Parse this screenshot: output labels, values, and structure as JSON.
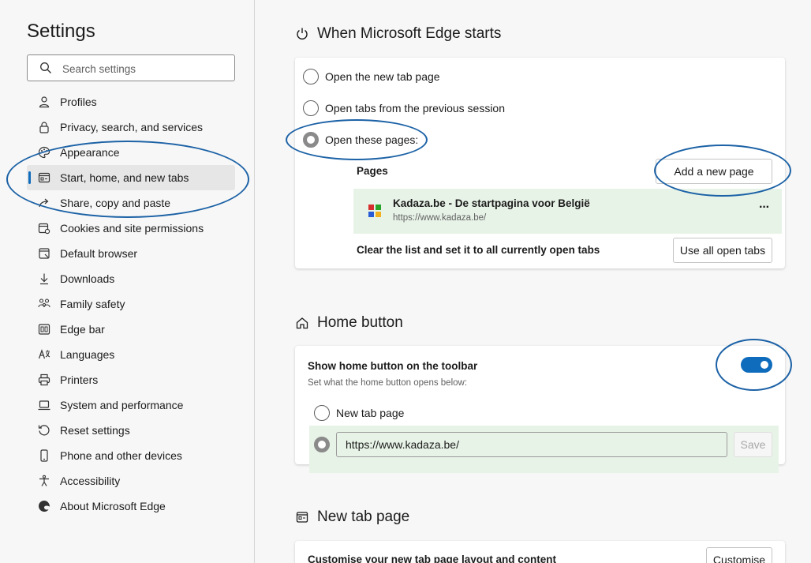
{
  "sidebar": {
    "title": "Settings",
    "search_placeholder": "Search settings",
    "items": [
      {
        "label": "Profiles",
        "icon": "profile-icon"
      },
      {
        "label": "Privacy, search, and services",
        "icon": "lock-icon"
      },
      {
        "label": "Appearance",
        "icon": "palette-icon"
      },
      {
        "label": "Start, home, and new tabs",
        "icon": "start-tabs-icon",
        "active": true
      },
      {
        "label": "Share, copy and paste",
        "icon": "share-icon"
      },
      {
        "label": "Cookies and site permissions",
        "icon": "cookies-icon"
      },
      {
        "label": "Default browser",
        "icon": "browser-icon"
      },
      {
        "label": "Downloads",
        "icon": "download-icon"
      },
      {
        "label": "Family safety",
        "icon": "family-icon"
      },
      {
        "label": "Edge bar",
        "icon": "edge-bar-icon"
      },
      {
        "label": "Languages",
        "icon": "languages-icon"
      },
      {
        "label": "Printers",
        "icon": "printer-icon"
      },
      {
        "label": "System and performance",
        "icon": "laptop-icon"
      },
      {
        "label": "Reset settings",
        "icon": "reset-icon"
      },
      {
        "label": "Phone and other devices",
        "icon": "phone-icon"
      },
      {
        "label": "Accessibility",
        "icon": "accessibility-icon"
      },
      {
        "label": "About Microsoft Edge",
        "icon": "edge-logo-icon"
      }
    ]
  },
  "startup": {
    "title": "When Microsoft Edge starts",
    "options": [
      {
        "label": "Open the new tab page",
        "checked": false
      },
      {
        "label": "Open tabs from the previous session",
        "checked": false
      },
      {
        "label": "Open these pages:",
        "checked": true
      }
    ],
    "pages_label": "Pages",
    "add_page_label": "Add a new page",
    "page_entry": {
      "title": "Kadaza.be - De startpagina voor België",
      "url": "https://www.kadaza.be/",
      "more": "···"
    },
    "clear_label": "Clear the list and set it to all currently open tabs",
    "use_all_label": "Use all open tabs"
  },
  "home_button": {
    "title": "Home button",
    "show_label": "Show home button on the toolbar",
    "description": "Set what the home button opens below:",
    "toggle_on": true,
    "options": [
      {
        "label": "New tab page",
        "checked": false
      }
    ],
    "url_value": "https://www.kadaza.be/",
    "save_label": "Save"
  },
  "new_tab": {
    "title": "New tab page",
    "customise_label": "Customise your new tab page layout and content",
    "customise_button": "Customise"
  },
  "colors": {
    "accent": "#0f6cbd",
    "highlight_green": "#e8f3e8",
    "annotation_circle": "#1c62a6"
  }
}
